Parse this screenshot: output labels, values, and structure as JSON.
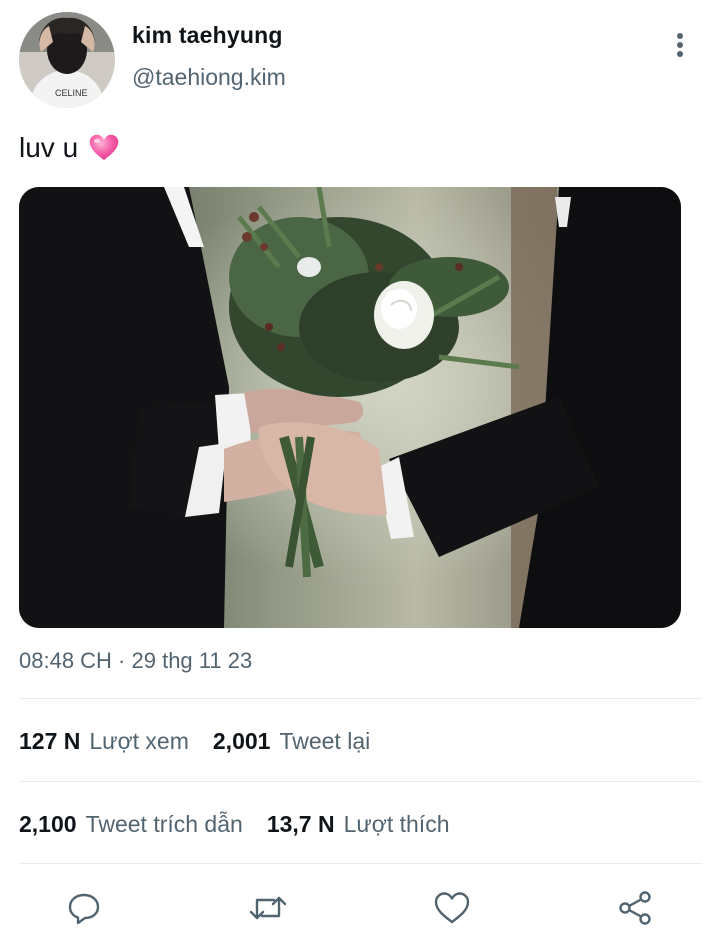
{
  "user": {
    "display_name": "kim taehyung",
    "handle": "@taehiong.kim",
    "avatar_shirt_text": "CELINE"
  },
  "tweet": {
    "text": "luv u",
    "emoji": "pink-heart",
    "timestamp": "08:48 CH · 29 thg 11 23"
  },
  "stats": {
    "views_count": "127 N",
    "views_label": "Lượt xem",
    "retweets_count": "2,001",
    "retweets_label": "Tweet lại",
    "quotes_count": "2,100",
    "quotes_label": "Tweet trích dẫn",
    "likes_count": "13,7 N",
    "likes_label": "Lượt thích"
  },
  "actions": {
    "reply": "reply-icon",
    "retweet": "retweet-icon",
    "like": "heart-icon",
    "share": "share-icon"
  },
  "colors": {
    "text_primary": "#0f1419",
    "text_secondary": "#536471",
    "divider": "#e6ecf0",
    "icon": "#536471",
    "emoji_pink": "#f45aa6"
  }
}
